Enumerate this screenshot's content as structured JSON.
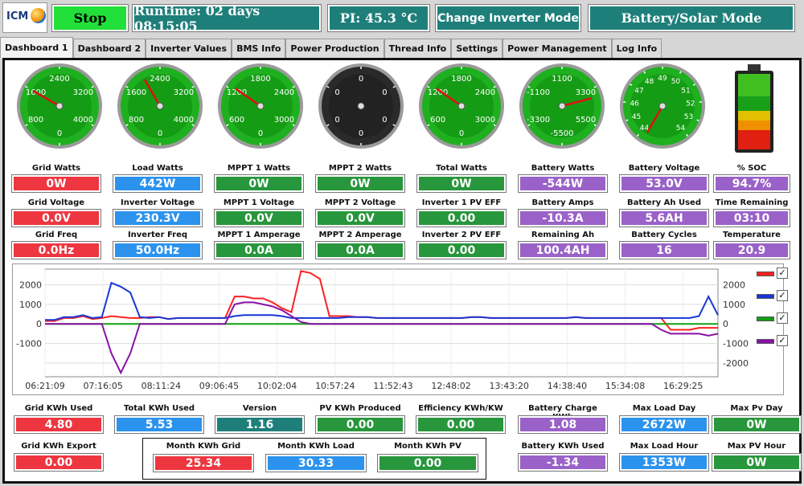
{
  "header": {
    "logo_text": "ICM",
    "stop_label": "Stop",
    "runtime": "Runtime: 02 days 08:15:05",
    "pi_temp": "PI: 45.3 °C",
    "change_mode_label": "Change Inverter Mode",
    "mode": "Battery/Solar Mode"
  },
  "tabs": [
    "Dashboard 1",
    "Dashboard 2",
    "Inverter Values",
    "BMS Info",
    "Power Production",
    "Thread Info",
    "Settings",
    "Power Management",
    "Log Info"
  ],
  "colors": {
    "red": "#ee3640",
    "blue": "#2b93ee",
    "green": "#28963c",
    "purple": "#9a62c8",
    "teal": "#1e7f7a",
    "stop": "#22e03a"
  },
  "gauges": [
    {
      "name": "grid-watts-gauge",
      "ticks": [
        "800",
        "1600",
        "2400",
        "3200",
        "4000",
        "0"
      ]
    },
    {
      "name": "load-watts-gauge",
      "ticks": [
        "800",
        "1600",
        "2400",
        "3200",
        "4000",
        "0"
      ]
    },
    {
      "name": "mppt1-watts-gauge",
      "ticks": [
        "600",
        "1200",
        "1800",
        "2400",
        "3000",
        "0"
      ]
    },
    {
      "name": "mppt2-watts-gauge",
      "ticks": [
        "0",
        "0",
        "0",
        "0",
        "0",
        "0"
      ]
    },
    {
      "name": "total-watts-gauge",
      "ticks": [
        "600",
        "1200",
        "1800",
        "2400",
        "3000",
        "0"
      ]
    },
    {
      "name": "battery-watts-gauge",
      "ticks": [
        "-3300",
        "-1100",
        "1100",
        "3300",
        "5500",
        "-5500"
      ]
    },
    {
      "name": "battery-voltage-gauge",
      "ticks": [
        "44",
        "45",
        "46",
        "47",
        "48",
        "49",
        "50",
        "51",
        "52",
        "53",
        "54"
      ]
    }
  ],
  "metrics": {
    "row1": [
      {
        "label": "Grid Watts",
        "value": "0W",
        "color": "red"
      },
      {
        "label": "Load Watts",
        "value": "442W",
        "color": "blue"
      },
      {
        "label": "MPPT 1 Watts",
        "value": "0W",
        "color": "green"
      },
      {
        "label": "MPPT 2 Watts",
        "value": "0W",
        "color": "green"
      },
      {
        "label": "Total Watts",
        "value": "0W",
        "color": "green"
      },
      {
        "label": "Battery Watts",
        "value": "-544W",
        "color": "purple"
      },
      {
        "label": "Battery Voltage",
        "value": "53.0V",
        "color": "purple"
      },
      {
        "label": "% SOC",
        "value": "94.7%",
        "color": "purple"
      }
    ],
    "row2": [
      {
        "label": "Grid Voltage",
        "value": "0.0V",
        "color": "red"
      },
      {
        "label": "Inverter Voltage",
        "value": "230.3V",
        "color": "blue"
      },
      {
        "label": "MPPT 1 Voltage",
        "value": "0.0V",
        "color": "green"
      },
      {
        "label": "MPPT 2 Voltage",
        "value": "0.0V",
        "color": "green"
      },
      {
        "label": "Inverter 1 PV EFF",
        "value": "0.00",
        "color": "green"
      },
      {
        "label": "Battery Amps",
        "value": "-10.3A",
        "color": "purple"
      },
      {
        "label": "Battery Ah Used",
        "value": "5.6AH",
        "color": "purple"
      },
      {
        "label": "Time Remaining",
        "value": "03:10",
        "color": "purple"
      }
    ],
    "row3": [
      {
        "label": "Grid Freq",
        "value": "0.0Hz",
        "color": "red"
      },
      {
        "label": "Inverter Freq",
        "value": "50.0Hz",
        "color": "blue"
      },
      {
        "label": "MPPT 1 Amperage",
        "value": "0.0A",
        "color": "green"
      },
      {
        "label": "MPPT 2 Amperage",
        "value": "0.0A",
        "color": "green"
      },
      {
        "label": "Inverter 2 PV EFF",
        "value": "0.00",
        "color": "green"
      },
      {
        "label": "Remaining Ah",
        "value": "100.4AH",
        "color": "purple"
      },
      {
        "label": "Battery Cycles",
        "value": "16",
        "color": "purple"
      },
      {
        "label": "Temperature",
        "value": "20.9",
        "color": "purple"
      }
    ]
  },
  "bottom": {
    "row1": [
      {
        "label": "Grid KWh Used",
        "value": "4.80",
        "color": "red"
      },
      {
        "label": "Total KWh Used",
        "value": "5.53",
        "color": "blue"
      },
      {
        "label": "Version",
        "value": "1.16",
        "color": "teal"
      },
      {
        "label": "PV KWh Produced",
        "value": "0.00",
        "color": "green"
      },
      {
        "label": "Efficiency KWh/KW",
        "value": "0.00",
        "color": "green"
      },
      {
        "label": "Battery Charge KWh",
        "value": "1.08",
        "color": "purple"
      },
      {
        "label": "Max Load Day",
        "value": "2672W",
        "color": "blue"
      },
      {
        "label": "Max Pv Day",
        "value": "0W",
        "color": "green"
      }
    ],
    "grid_export": {
      "label": "Grid KWh Export",
      "value": "0.00",
      "color": "red"
    },
    "month": [
      {
        "label": "Month KWh Grid",
        "value": "25.34",
        "color": "red"
      },
      {
        "label": "Month KWh Load",
        "value": "30.33",
        "color": "blue"
      },
      {
        "label": "Month KWh PV",
        "value": "0.00",
        "color": "green"
      }
    ],
    "row2_right": [
      {
        "label": "Battery KWh Used",
        "value": "-1.34",
        "color": "purple"
      },
      {
        "label": "Max Load Hour",
        "value": "1353W",
        "color": "blue"
      },
      {
        "label": "Max PV Hour",
        "value": "0W",
        "color": "green"
      }
    ]
  },
  "battery_soc": 94.7,
  "chart_data": {
    "type": "line",
    "x_ticks": [
      "06:21:09",
      "07:16:05",
      "08:11:24",
      "09:06:45",
      "10:02:04",
      "10:57:24",
      "11:52:43",
      "12:48:02",
      "13:43:20",
      "14:38:40",
      "15:34:08",
      "16:29:25"
    ],
    "y_ticks": [
      "2000",
      "1000",
      "0",
      "-1000"
    ],
    "y_ticks_right": [
      "2000",
      "1000",
      "0",
      "-1000",
      "-2000"
    ],
    "ylim": [
      -2700,
      2800
    ],
    "grid": true,
    "legend_position": "right",
    "series": [
      {
        "color": "#ff2020",
        "checked": "✓",
        "values": [
          150,
          150,
          300,
          300,
          400,
          250,
          300,
          400,
          350,
          300,
          300,
          350,
          350,
          250,
          300,
          300,
          300,
          300,
          300,
          300,
          1400,
          1400,
          1300,
          1300,
          1100,
          800,
          600,
          2700,
          2600,
          2300,
          400,
          400,
          400,
          350,
          350,
          300,
          300,
          300,
          300,
          300,
          300,
          300,
          300,
          300,
          300,
          350,
          350,
          300,
          300,
          300,
          300,
          300,
          300,
          300,
          300,
          300,
          350,
          300,
          300,
          300,
          300,
          300,
          300,
          300,
          300,
          300,
          -300,
          -300,
          -300,
          -200,
          -200,
          -200
        ]
      },
      {
        "color": "#1836d8",
        "checked": "✓",
        "values": [
          200,
          200,
          350,
          350,
          450,
          300,
          350,
          2100,
          1900,
          1600,
          350,
          300,
          350,
          250,
          300,
          300,
          300,
          300,
          300,
          300,
          400,
          450,
          450,
          450,
          450,
          400,
          300,
          300,
          300,
          300,
          300,
          300,
          350,
          350,
          350,
          300,
          300,
          300,
          300,
          300,
          300,
          300,
          300,
          300,
          300,
          350,
          350,
          300,
          300,
          300,
          300,
          300,
          300,
          300,
          300,
          300,
          350,
          300,
          300,
          300,
          300,
          300,
          300,
          300,
          300,
          300,
          300,
          300,
          300,
          400,
          1400,
          450
        ]
      },
      {
        "color": "#10a010",
        "checked": "✓",
        "values": [
          0,
          0,
          0,
          0,
          0,
          0,
          0,
          0,
          0,
          0,
          0,
          0,
          0,
          0,
          0,
          0,
          0,
          0,
          0,
          0,
          0,
          0,
          0,
          0,
          0,
          0,
          0,
          0,
          0,
          0,
          0,
          0,
          0,
          0,
          0,
          0,
          0,
          0,
          0,
          0,
          0,
          0,
          0,
          0,
          0,
          0,
          0,
          0,
          0,
          0,
          0,
          0,
          0,
          0,
          0,
          0,
          0,
          0,
          0,
          0,
          0,
          0,
          0,
          0,
          0,
          0,
          0,
          0,
          0,
          0,
          0,
          0
        ]
      },
      {
        "color": "#8a10a8",
        "checked": "✓",
        "values": [
          0,
          0,
          0,
          0,
          0,
          0,
          0,
          -1500,
          -2500,
          -1500,
          0,
          0,
          0,
          0,
          0,
          0,
          0,
          0,
          0,
          0,
          1000,
          1100,
          1100,
          1000,
          900,
          700,
          400,
          100,
          0,
          0,
          0,
          0,
          0,
          0,
          0,
          0,
          0,
          0,
          0,
          0,
          0,
          0,
          0,
          0,
          0,
          0,
          0,
          0,
          0,
          0,
          0,
          0,
          0,
          0,
          0,
          0,
          0,
          0,
          0,
          0,
          0,
          0,
          0,
          0,
          0,
          -300,
          -500,
          -500,
          -500,
          -500,
          -600,
          -500
        ]
      }
    ]
  }
}
